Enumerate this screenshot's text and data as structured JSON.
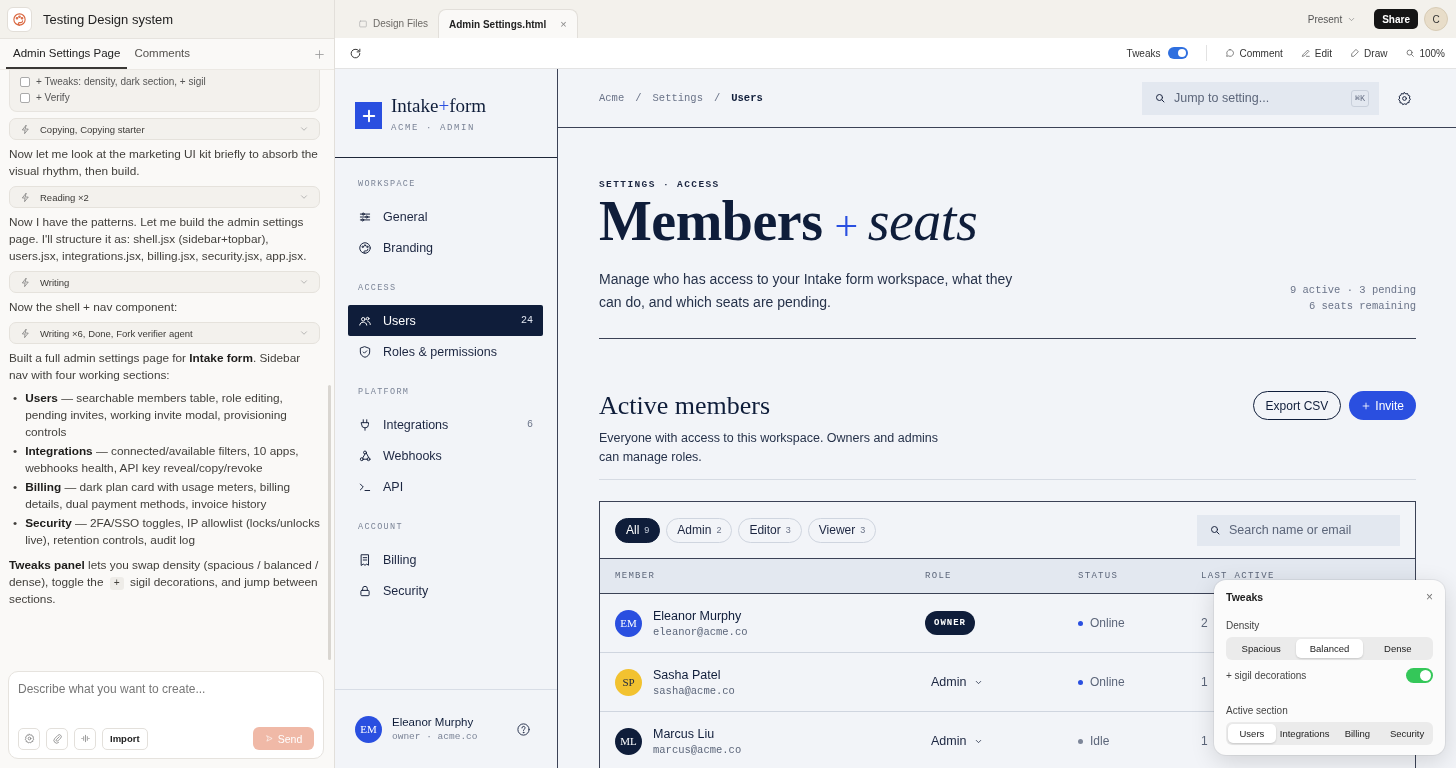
{
  "project": {
    "title": "Testing Design system"
  },
  "chat_tabs": [
    {
      "label": "Admin Settings Page",
      "selected": true
    },
    {
      "label": "Comments",
      "selected": false
    }
  ],
  "chat": [
    {
      "kind": "checklist",
      "items": [
        {
          "label": "+ Tweaks: density, dark section, + sigil",
          "checked": false
        },
        {
          "label": "+ Verify",
          "checked": false
        }
      ]
    },
    {
      "kind": "tool",
      "label": "Copying, Copying starter"
    },
    {
      "kind": "text",
      "text": "Now let me look at the marketing UI kit briefly to absorb the visual rhythm, then build."
    },
    {
      "kind": "tool",
      "label": "Reading ×2"
    },
    {
      "kind": "text",
      "text": "Now I have the patterns. Let me build the admin settings page. I'll structure it as: shell.jsx (sidebar+topbar), users.jsx, integrations.jsx, billing.jsx, security.jsx, app.jsx."
    },
    {
      "kind": "tool",
      "label": "Writing"
    },
    {
      "kind": "text",
      "text": "Now the shell + nav component:"
    },
    {
      "kind": "tool",
      "label": "Writing ×6, Done, Fork verifier agent"
    },
    {
      "kind": "text",
      "text": "Built a full admin settings page for **Intake form**. Sidebar nav with four working sections:"
    },
    {
      "kind": "bullets",
      "items": [
        {
          "marker": "•",
          "text": "**Users** — searchable members table, role editing, pending invites, working invite modal, provisioning controls"
        },
        {
          "marker": "•",
          "text": "**Integrations** — connected/available filters, 10 apps, webhooks health, API key reveal/copy/revoke"
        },
        {
          "marker": "•",
          "text": "**Billing** — dark plan card with usage meters, billing details, dual payment methods, invoice history"
        },
        {
          "marker": "•",
          "text": "**Security** — 2FA/SSO toggles, IP allowlist (locks/unlocks live), retention controls, audit log"
        }
      ]
    },
    {
      "kind": "text",
      "text": "**Tweaks panel** lets you swap density (spacious / balanced / dense), toggle the",
      "code": "+",
      "text_after": "sigil decorations, and jump between sections."
    }
  ],
  "composer": {
    "placeholder": "Describe what you want to create...",
    "import": "Import",
    "send": "Send",
    "send_disabled": true
  },
  "file_tabs": [
    {
      "label": "Design Files",
      "selected": false
    },
    {
      "label": "Admin Settings.html",
      "selected": true,
      "close": "×"
    }
  ],
  "top_actions": {
    "present": "Present",
    "share": "Share",
    "avatar": "C"
  },
  "toolbar": {
    "tweaks": {
      "label": "Tweaks",
      "on": true
    },
    "actions": [
      "Comment",
      "Edit",
      "Draw"
    ],
    "zoom": "100%"
  },
  "sidebar": {
    "brand": {
      "name": "Intake",
      "sigil": "+",
      "name_end": "form",
      "subtitle": "ACME · ADMIN"
    },
    "sections": [
      {
        "title": "WORKSPACE",
        "items": [
          {
            "label": "General",
            "selected": false
          },
          {
            "label": "Branding",
            "selected": false
          }
        ]
      },
      {
        "title": "ACCESS",
        "items": [
          {
            "label": "Users",
            "count": "24",
            "selected": true
          },
          {
            "label": "Roles & permissions",
            "selected": false
          }
        ]
      },
      {
        "title": "PLATFORM",
        "items": [
          {
            "label": "Integrations",
            "count": "6",
            "selected": false
          },
          {
            "label": "Webhooks",
            "selected": false
          },
          {
            "label": "API",
            "selected": false
          }
        ]
      },
      {
        "title": "ACCOUNT",
        "items": [
          {
            "label": "Billing",
            "selected": false
          },
          {
            "label": "Security",
            "selected": false
          }
        ]
      }
    ],
    "user": {
      "initials": "EM",
      "name": "Eleanor Murphy",
      "meta": "owner · acme.co"
    }
  },
  "topbar": {
    "breadcrumbs": [
      {
        "kind": "link",
        "text": "Acme"
      },
      {
        "kind": "sep",
        "text": "/"
      },
      {
        "kind": "link",
        "text": "Settings"
      },
      {
        "kind": "sep",
        "text": "/"
      },
      {
        "kind": "current",
        "text": "Users"
      }
    ],
    "search": {
      "placeholder": "Jump to setting...",
      "shortcut": "⌘K"
    }
  },
  "header": {
    "eyebrow": "SETTINGS · ACCESS",
    "title": "Members",
    "sigil": "+",
    "title_italic": "seats",
    "description": "Manage who has access to your Intake form workspace, what they can do, and which seats are pending.",
    "stats": [
      "9 active · 3 pending",
      "6 seats remaining"
    ]
  },
  "members": {
    "title": "Active members",
    "description": "Everyone with access to this workspace. Owners and admins can manage roles.",
    "export": "Export CSV",
    "invite": "Invite",
    "filters": [
      {
        "label": "All",
        "count": "9",
        "selected": true
      },
      {
        "label": "Admin",
        "count": "2",
        "selected": false
      },
      {
        "label": "Editor",
        "count": "3",
        "selected": false
      },
      {
        "label": "Viewer",
        "count": "3",
        "selected": false
      }
    ],
    "search_placeholder": "Search name or email",
    "columns": [
      "MEMBER",
      "ROLE",
      "STATUS",
      "LAST ACTIVE"
    ],
    "rows": [
      {
        "initials": "EM",
        "color": "#2a4fe0",
        "name": "Eleanor Murphy",
        "email": "eleanor@acme.co",
        "role": {
          "kind": "badge",
          "text": "OWNER"
        },
        "status": {
          "text": "Online",
          "color": "#2a4fe0"
        },
        "last_active": "2"
      },
      {
        "initials": "SP",
        "color": "#f2c230",
        "name": "Sasha Patel",
        "email": "sasha@acme.co",
        "role": {
          "kind": "select",
          "text": "Admin"
        },
        "status": {
          "text": "Online",
          "color": "#2a4fe0"
        },
        "last_active": "1"
      },
      {
        "initials": "ML",
        "color": "#0f1d3a",
        "name": "Marcus Liu",
        "email": "marcus@acme.co",
        "role": {
          "kind": "select",
          "text": "Admin"
        },
        "status": {
          "text": "Idle",
          "color": "#7d8699"
        },
        "last_active": "1"
      }
    ]
  },
  "tweaks_panel": {
    "title": "Tweaks",
    "close": "×",
    "density_label": "Density",
    "density": [
      {
        "label": "Spacious",
        "selected": false
      },
      {
        "label": "Balanced",
        "selected": true
      },
      {
        "label": "Dense",
        "selected": false
      }
    ],
    "sigil": {
      "label": "+ sigil decorations",
      "on": true
    },
    "section_label": "Active section",
    "sections": [
      {
        "label": "Users",
        "selected": true
      },
      {
        "label": "Integrations",
        "selected": false
      },
      {
        "label": "Billing",
        "selected": false
      },
      {
        "label": "Security",
        "selected": false
      }
    ]
  }
}
